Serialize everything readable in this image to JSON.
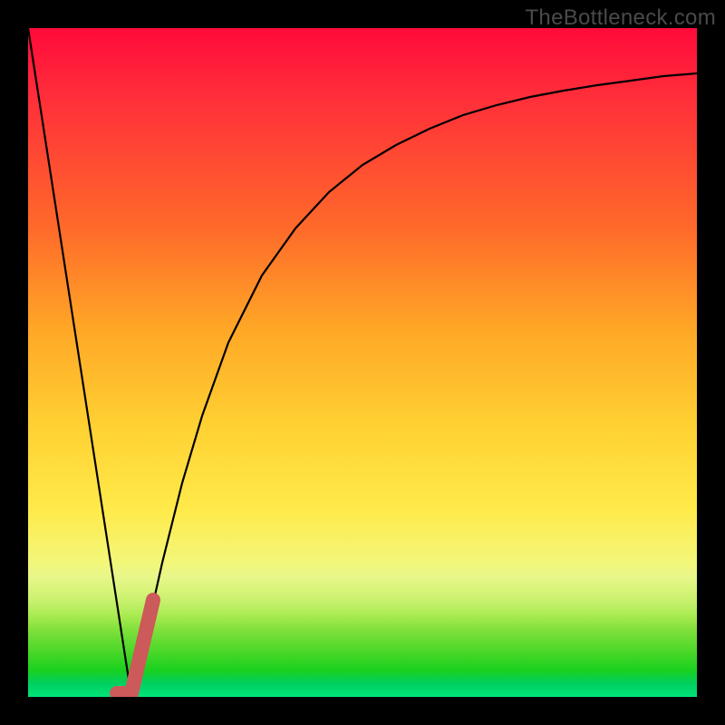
{
  "watermark": "TheBottleneck.com",
  "colors": {
    "frame": "#000000",
    "curve": "#000000",
    "highlight": "#cc5a5a",
    "gradient_top": "#ff0a3a",
    "gradient_bottom": "#00e37a"
  },
  "chart_data": {
    "type": "line",
    "title": "",
    "xlabel": "",
    "ylabel": "",
    "xlim": [
      0,
      100
    ],
    "ylim": [
      0,
      100
    ],
    "series": [
      {
        "name": "left-falling-line",
        "x": [
          0,
          15.5
        ],
        "y": [
          100,
          0
        ]
      },
      {
        "name": "right-rising-curve",
        "x": [
          15.5,
          18,
          20,
          23,
          26,
          30,
          35,
          40,
          45,
          50,
          55,
          60,
          65,
          70,
          75,
          80,
          85,
          90,
          95,
          100
        ],
        "y": [
          0,
          11,
          20,
          32,
          42,
          53,
          63,
          70,
          75.5,
          79.5,
          82.5,
          85,
          87,
          88.5,
          89.7,
          90.7,
          91.5,
          92.2,
          92.8,
          93.3
        ]
      },
      {
        "name": "highlight-j-segment",
        "points": [
          {
            "x": 13.3,
            "y": 0.5
          },
          {
            "x": 15.5,
            "y": 0.5
          },
          {
            "x": 18.7,
            "y": 14.5
          }
        ]
      }
    ],
    "annotations": []
  }
}
